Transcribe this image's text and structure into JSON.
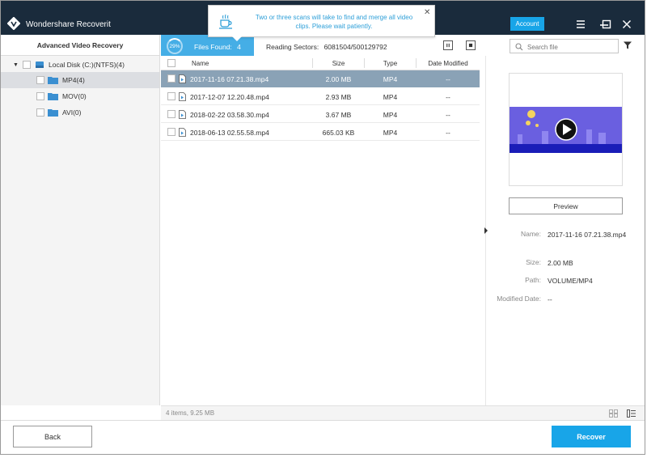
{
  "app": {
    "title": "Wondershare Recoverit",
    "account_label": "Account"
  },
  "notification": {
    "message": "Two or three scans will take to find and merge all video clips. Please wait patiently.",
    "close": "✕"
  },
  "sidebar": {
    "header": "Advanced Video Recovery",
    "drive": {
      "label": "Local Disk (C:)(NTFS)(4)"
    },
    "folders": [
      {
        "label": "MP4(4)"
      },
      {
        "label": "MOV(0)"
      },
      {
        "label": "AVI(0)"
      }
    ]
  },
  "scan": {
    "progress_label": "29%",
    "progress": 0.29,
    "files_found_label": "Files Found:",
    "files_found": "4",
    "reading_label": "Reading Sectors:",
    "reading_value": "6081504/500129792"
  },
  "search": {
    "placeholder": "Search file"
  },
  "table": {
    "columns": {
      "name": "Name",
      "size": "Size",
      "type": "Type",
      "modified": "Date Modified"
    },
    "rows": [
      {
        "name": "2017-11-16 07.21.38.mp4",
        "size": "2.00 MB",
        "type": "MP4",
        "modified": "--"
      },
      {
        "name": "2017-12-07 12.20.48.mp4",
        "size": "2.93 MB",
        "type": "MP4",
        "modified": "--"
      },
      {
        "name": "2018-02-22 03.58.30.mp4",
        "size": "3.67 MB",
        "type": "MP4",
        "modified": "--"
      },
      {
        "name": "2018-06-13 02.55.58.mp4",
        "size": "665.03 KB",
        "type": "MP4",
        "modified": "--"
      }
    ]
  },
  "preview": {
    "button_label": "Preview",
    "name_label": "Name:",
    "name_value": "2017-11-16 07.21.38.mp4",
    "size_label": "Size:",
    "size_value": "2.00 MB",
    "path_label": "Path:",
    "path_value": "VOLUME/MP4",
    "modified_label": "Modified Date:",
    "modified_value": "--"
  },
  "footer": {
    "items_summary": "4 items, 9.25 MB",
    "back_label": "Back",
    "recover_label": "Recover"
  },
  "colors": {
    "titlebar": "#1a2b3c",
    "accent": "#18a5e8",
    "progress": "#45aee6",
    "selected_row": "#8aa2b6"
  }
}
